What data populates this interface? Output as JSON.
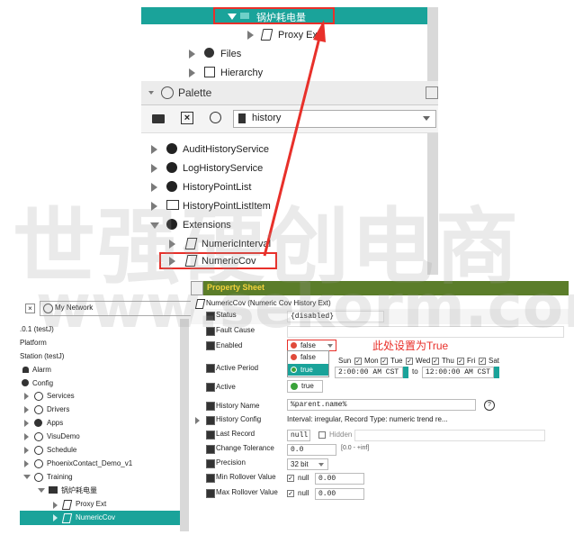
{
  "top_tree": {
    "selected_label": "锅炉耗电量",
    "proxy_ext": "Proxy Ext",
    "files": "Files",
    "hierarchy": "Hierarchy"
  },
  "palette": {
    "title": "Palette",
    "module": "history",
    "items": [
      "AuditHistoryService",
      "LogHistoryService",
      "HistoryPointList",
      "HistoryPointListItem",
      "Extensions",
      "NumericInterval",
      "NumericCov"
    ]
  },
  "nav": {
    "selector": "My Network",
    "items": [
      ".0.1 (testJ)",
      "Platform",
      "Station (testJ)",
      "Alarm",
      "Config",
      "Services",
      "Drivers",
      "Apps",
      "VisuDemo",
      "Schedule",
      "PhoenixContact_Demo_v1",
      "Training",
      "锅炉耗电量",
      "Proxy Ext",
      "NumericCov"
    ]
  },
  "sheet": {
    "title": "Property Sheet",
    "object": "NumericCov  (Numeric Cov History Ext)",
    "status_label": "Status",
    "status_value": "{disabled}",
    "fault_label": "Fault Cause",
    "enabled_label": "Enabled",
    "enabled_value": "false",
    "option_false": "false",
    "option_true": "true",
    "active_period_label": "Active Period",
    "days": [
      "Sun",
      "Mon",
      "Tue",
      "Wed",
      "Thu",
      "Fri",
      "Sat"
    ],
    "time_start": "2:00:00 AM CST",
    "time_to": "to",
    "time_end": "12:00:00 AM CST",
    "active_label": "Active",
    "active_value": "true",
    "history_name_label": "History Name",
    "history_name_value": "%parent.name%",
    "history_config_label": "History Config",
    "history_config_value": "Interval: irregular, Record Type: numeric trend re...",
    "last_record_label": "Last Record",
    "last_record_value": "null",
    "hidden_label": "Hidden",
    "change_tol_label": "Change Tolerance",
    "change_tol_value": "0.0",
    "change_tol_range": "[0.0 - +inf]",
    "precision_label": "Precision",
    "precision_value": "32 bit",
    "min_rollover_label": "Min Rollover Value",
    "max_rollover_label": "Max Rollover Value",
    "null_label": "null",
    "rollover_value": "0.00"
  },
  "annotation": "此处设置为True",
  "watermark": {
    "line1": "世强硬创电商",
    "line2": "www.sekorm.com"
  },
  "colors": {
    "accent": "#1aa39a",
    "annotation": "#e8302a",
    "status_green": "#3aa33a",
    "status_red": "#e04a3a"
  }
}
